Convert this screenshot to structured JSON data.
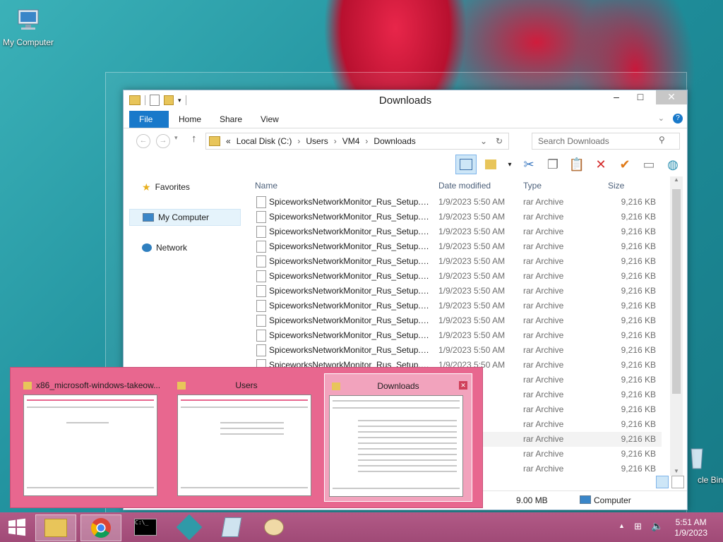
{
  "desktop": {
    "my_computer_label": "My Computer",
    "recycle_bin_label": "cle Bin"
  },
  "window": {
    "title": "Downloads",
    "ribbon_tabs": [
      "File",
      "Home",
      "Share",
      "View"
    ],
    "breadcrumb": [
      "Local Disk (C:)",
      "Users",
      "VM4",
      "Downloads"
    ],
    "breadcrumb_prefix": "«",
    "search_placeholder": "Search Downloads",
    "columns": {
      "name": "Name",
      "date": "Date modified",
      "type": "Type",
      "size": "Size"
    },
    "nav": [
      {
        "label": "Favorites",
        "icon": "star-icon"
      },
      {
        "label": "My Computer",
        "icon": "computer-icon"
      },
      {
        "label": "Network",
        "icon": "network-icon"
      }
    ],
    "files": [
      {
        "name": "SpiceworksNetworkMonitor_Rus_Setup.p...",
        "date": "1/9/2023 5:50 AM",
        "type": "rar Archive",
        "size": "9,216 KB"
      },
      {
        "name": "SpiceworksNetworkMonitor_Rus_Setup.p...",
        "date": "1/9/2023 5:50 AM",
        "type": "rar Archive",
        "size": "9,216 KB"
      },
      {
        "name": "SpiceworksNetworkMonitor_Rus_Setup.p...",
        "date": "1/9/2023 5:50 AM",
        "type": "rar Archive",
        "size": "9,216 KB"
      },
      {
        "name": "SpiceworksNetworkMonitor_Rus_Setup.p...",
        "date": "1/9/2023 5:50 AM",
        "type": "rar Archive",
        "size": "9,216 KB"
      },
      {
        "name": "SpiceworksNetworkMonitor_Rus_Setup.p...",
        "date": "1/9/2023 5:50 AM",
        "type": "rar Archive",
        "size": "9,216 KB"
      },
      {
        "name": "SpiceworksNetworkMonitor_Rus_Setup.p...",
        "date": "1/9/2023 5:50 AM",
        "type": "rar Archive",
        "size": "9,216 KB"
      },
      {
        "name": "SpiceworksNetworkMonitor_Rus_Setup.p...",
        "date": "1/9/2023 5:50 AM",
        "type": "rar Archive",
        "size": "9,216 KB"
      },
      {
        "name": "SpiceworksNetworkMonitor_Rus_Setup.p...",
        "date": "1/9/2023 5:50 AM",
        "type": "rar Archive",
        "size": "9,216 KB"
      },
      {
        "name": "SpiceworksNetworkMonitor_Rus_Setup.p...",
        "date": "1/9/2023 5:50 AM",
        "type": "rar Archive",
        "size": "9,216 KB"
      },
      {
        "name": "SpiceworksNetworkMonitor_Rus_Setup.p...",
        "date": "1/9/2023 5:50 AM",
        "type": "rar Archive",
        "size": "9,216 KB"
      },
      {
        "name": "SpiceworksNetworkMonitor_Rus_Setup.p...",
        "date": "1/9/2023 5:50 AM",
        "type": "rar Archive",
        "size": "9,216 KB"
      },
      {
        "name": "SpiceworksNetworkMonitor_Rus_Setup.p...",
        "date": "1/9/2023 5:50 AM",
        "type": "rar Archive",
        "size": "9,216 KB"
      },
      {
        "name": "",
        "date": "",
        "type": "rar Archive",
        "size": "9,216 KB"
      },
      {
        "name": "",
        "date": "",
        "type": "rar Archive",
        "size": "9,216 KB"
      },
      {
        "name": "",
        "date": "",
        "type": "rar Archive",
        "size": "9,216 KB"
      },
      {
        "name": "",
        "date": "",
        "type": "rar Archive",
        "size": "9,216 KB"
      },
      {
        "name": "",
        "date": "49 AM",
        "type": "rar Archive",
        "size": "9,216 KB"
      },
      {
        "name": "",
        "date": "49 AM",
        "type": "rar Archive",
        "size": "9,216 KB"
      },
      {
        "name": "",
        "date": "49 AM",
        "type": "rar Archive",
        "size": "9,216 KB"
      }
    ],
    "status": {
      "size": "9.00 MB",
      "location": "Computer"
    }
  },
  "switcher": {
    "windows": [
      {
        "title": "x86_microsoft-windows-takeow...",
        "selected": false
      },
      {
        "title": "Users",
        "selected": false
      },
      {
        "title": "Downloads",
        "selected": true
      }
    ]
  },
  "taskbar": {
    "apps": [
      "explorer",
      "chrome",
      "cmd",
      "regedit",
      "notepad",
      "paint"
    ],
    "time": "5:51 AM",
    "date": "1/9/2023"
  },
  "colors": {
    "file_tab": "#1979ca",
    "taskbar": "#a04a77",
    "switcher": "#e8678f"
  }
}
